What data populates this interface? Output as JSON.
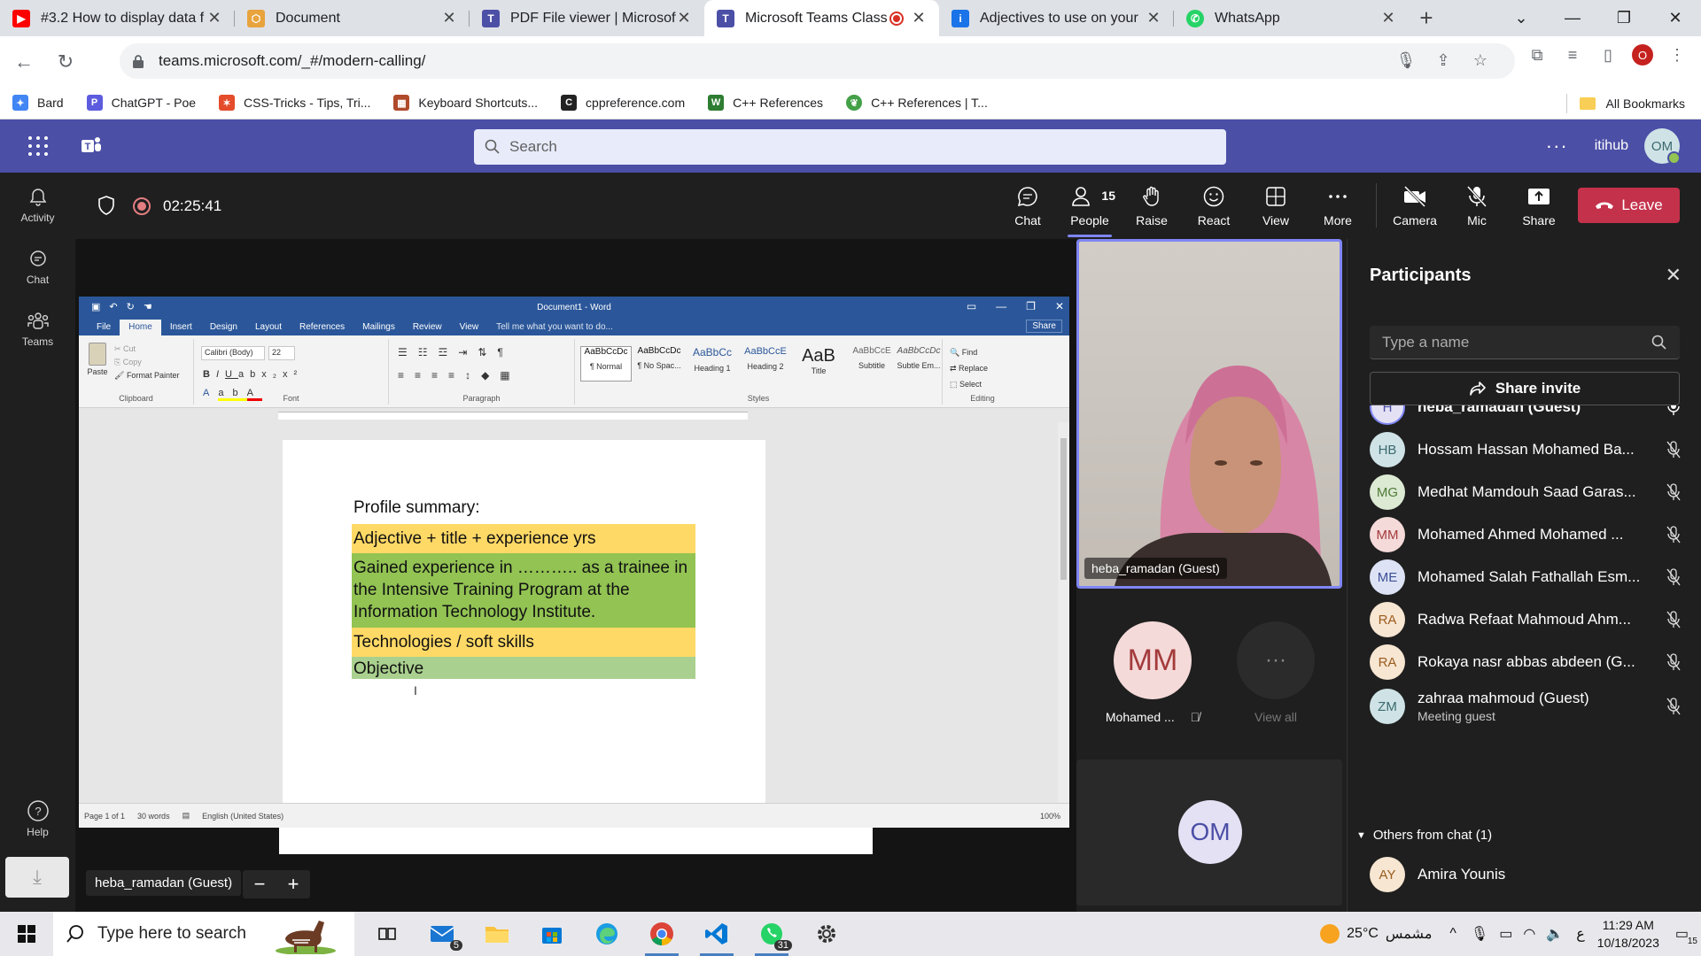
{
  "browser": {
    "tabs": [
      {
        "title": "#3.2 How to display data f",
        "icon": "youtube-icon",
        "color": "#ff0000"
      },
      {
        "title": "Document",
        "icon": "codepen-icon",
        "color": "#e8a33d"
      },
      {
        "title": "PDF File viewer | Microsoft",
        "icon": "teams-icon",
        "color": "#4b4fa6"
      },
      {
        "title": "Microsoft Teams Class",
        "icon": "teams-icon",
        "color": "#4b4fa6"
      },
      {
        "title": "Adjectives to use on your",
        "icon": "info-icon",
        "color": "#1a73e8"
      },
      {
        "title": "WhatsApp",
        "icon": "whatsapp-icon",
        "color": "#25d366"
      }
    ],
    "url": "teams.microsoft.com/_#/modern-calling/",
    "profile_initial": "O",
    "bookmarks": [
      {
        "label": "Bard",
        "icon": "bard-icon",
        "color": "#4285f4"
      },
      {
        "label": "ChatGPT - Poe",
        "icon": "poe-icon",
        "color": "#5d5cde"
      },
      {
        "label": "CSS-Tricks - Tips, Tri...",
        "icon": "css-tricks-icon",
        "color": "#e44c2b"
      },
      {
        "label": "Keyboard Shortcuts...",
        "icon": "keyboard-icon",
        "color": "#b04a2b"
      },
      {
        "label": "cppreference.com",
        "icon": "cppreference-icon",
        "color": "#222222"
      },
      {
        "label": "C++ References",
        "icon": "w-icon",
        "color": "#2e7d32"
      },
      {
        "label": "C++ References | T...",
        "icon": "leaf-icon",
        "color": "#43a047"
      }
    ],
    "all_bookmarks": "All Bookmarks"
  },
  "teams": {
    "search_placeholder": "Search",
    "org": "itihub",
    "user_initials": "OM",
    "rail": [
      {
        "label": "Activity",
        "icon": "bell-icon"
      },
      {
        "label": "Chat",
        "icon": "chat-icon"
      },
      {
        "label": "Teams",
        "icon": "teams-group-icon"
      }
    ],
    "help": "Help",
    "meeting": {
      "timer": "02:25:41",
      "people_count": "15",
      "controls": [
        "Chat",
        "People",
        "Raise",
        "React",
        "View",
        "More"
      ],
      "av_controls": [
        "Camera",
        "Mic",
        "Share"
      ],
      "leave": "Leave"
    },
    "stage": {
      "presenter_name": "heba_ramadan (Guest)"
    },
    "video": {
      "main_label": "heba_ramadan (Guest)",
      "tile1_initials": "MM",
      "tile1_name": "Mohamed ...",
      "tile2_label": "View all",
      "self_initials": "OM"
    },
    "participants": {
      "title": "Participants",
      "search_placeholder": "Type a name",
      "share_invite": "Share invite",
      "list": [
        {
          "initials": "H",
          "name": "heba_ramadan (Guest)",
          "sub": "",
          "bg": "#e4e1f5",
          "fg": "#4b4fa6",
          "mic": "on"
        },
        {
          "initials": "HB",
          "name": "Hossam Hassan Mohamed Ba...",
          "sub": "",
          "bg": "#cfe3e6",
          "fg": "#3b6a70",
          "mic": "off"
        },
        {
          "initials": "MG",
          "name": "Medhat Mamdouh Saad Garas...",
          "sub": "",
          "bg": "#dcead4",
          "fg": "#4f7a36",
          "mic": "off"
        },
        {
          "initials": "MM",
          "name": "Mohamed Ahmed Mohamed ...",
          "sub": "",
          "bg": "#f5dada",
          "fg": "#a33b3b",
          "mic": "off"
        },
        {
          "initials": "ME",
          "name": "Mohamed Salah Fathallah Esm...",
          "sub": "",
          "bg": "#dde3f5",
          "fg": "#3d4f96",
          "mic": "off"
        },
        {
          "initials": "RA",
          "name": "Radwa Refaat Mahmoud Ahm...",
          "sub": "",
          "bg": "#f7e6d2",
          "fg": "#9a5c1e",
          "mic": "off"
        },
        {
          "initials": "RA",
          "name": "Rokaya nasr abbas abdeen (G...",
          "sub": "",
          "bg": "#f7e6d2",
          "fg": "#9a5c1e",
          "mic": "off"
        },
        {
          "initials": "ZM",
          "name": "zahraa mahmoud (Guest)",
          "sub": "Meeting guest",
          "bg": "#cfe3e6",
          "fg": "#3b6a70",
          "mic": "off"
        }
      ],
      "others_label": "Others from chat (1)",
      "others": [
        {
          "initials": "AY",
          "name": "Amira Younis",
          "bg": "#f7e6d2",
          "fg": "#9a5c1e"
        }
      ]
    }
  },
  "word": {
    "doc_title": "Document1 - Word",
    "tabs": [
      "File",
      "Home",
      "Insert",
      "Design",
      "Layout",
      "References",
      "Mailings",
      "Review",
      "View"
    ],
    "tell_me": "Tell me what you want to do...",
    "share": "Share",
    "font_name": "Calibri (Body)",
    "font_size": "22",
    "clipboard": {
      "paste": "Paste",
      "cut": "Cut",
      "copy": "Copy",
      "format_painter": "Format Painter"
    },
    "groups": [
      "Clipboard",
      "Font",
      "Paragraph",
      "Styles",
      "Editing"
    ],
    "styles": [
      {
        "preview": "AaBbCcDc",
        "name": "¶ Normal"
      },
      {
        "preview": "AaBbCcDc",
        "name": "¶ No Spac..."
      },
      {
        "preview": "AaBbCc",
        "name": "Heading 1"
      },
      {
        "preview": "AaBbCcE",
        "name": "Heading 2"
      },
      {
        "preview": "AaB",
        "name": "Title"
      },
      {
        "preview": "AaBbCcE",
        "name": "Subtitle"
      },
      {
        "preview": "AaBbCcDc",
        "name": "Subtle Em..."
      }
    ],
    "editing": [
      "Find",
      "Replace",
      "Select"
    ],
    "content": {
      "heading": "Profile summary:",
      "p1": "Adjective + title + experience yrs",
      "p2": "Gained experience in ……….. as a trainee in the Intensive Training Program at the Information Technology Institute.",
      "p3": "Technologies  / soft skills",
      "p4": "Objective"
    },
    "status": {
      "page": "Page 1 of 1",
      "words": "30 words",
      "language": "English (United States)",
      "zoom": "100%"
    }
  },
  "taskbar": {
    "search_placeholder": "Type here to search",
    "mail_badge": "5",
    "whatsapp_badge": "31",
    "weather": "25°C",
    "weather_text": "مشمس",
    "lang": "ع",
    "time": "11:29 AM",
    "date": "10/18/2023",
    "notif_count": "15"
  }
}
